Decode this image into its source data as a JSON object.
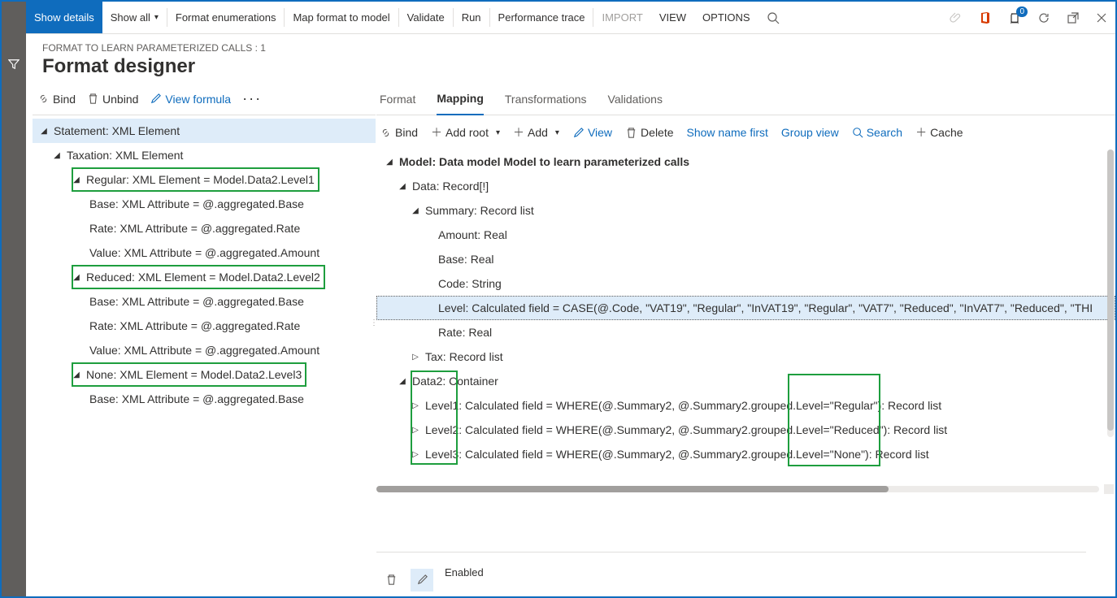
{
  "topbar": {
    "show_details": "Show details",
    "show_all": "Show all",
    "format_enum": "Format enumerations",
    "map_format": "Map format to model",
    "validate": "Validate",
    "run": "Run",
    "trace": "Performance trace",
    "import": "IMPORT",
    "view": "VIEW",
    "options": "OPTIONS",
    "notif_count": "0"
  },
  "header": {
    "crumb": "FORMAT TO LEARN PARAMETERIZED CALLS : 1",
    "title": "Format designer"
  },
  "left_tb": {
    "bind": "Bind",
    "unbind": "Unbind",
    "view_formula": "View formula"
  },
  "left_tree": {
    "n0": "Statement: XML Element",
    "n1": "Taxation: XML Element",
    "n2": "Regular: XML Element = Model.Data2.Level1",
    "n2a": "Base: XML Attribute = @.aggregated.Base",
    "n2b": "Rate: XML Attribute = @.aggregated.Rate",
    "n2c": "Value: XML Attribute = @.aggregated.Amount",
    "n3": "Reduced: XML Element = Model.Data2.Level2",
    "n3a": "Base: XML Attribute = @.aggregated.Base",
    "n3b": "Rate: XML Attribute = @.aggregated.Rate",
    "n3c": "Value: XML Attribute = @.aggregated.Amount",
    "n4": "None: XML Element = Model.Data2.Level3",
    "n4a": "Base: XML Attribute = @.aggregated.Base"
  },
  "tabs": {
    "format": "Format",
    "mapping": "Mapping",
    "transformations": "Transformations",
    "validations": "Validations"
  },
  "right_tb": {
    "bind": "Bind",
    "add_root": "Add root",
    "add": "Add",
    "view": "View",
    "delete": "Delete",
    "show_name": "Show name first",
    "group_view": "Group view",
    "search": "Search",
    "cache": "Cache"
  },
  "right_tree": {
    "r0": "Model: Data model Model to learn parameterized calls",
    "r1": "Data: Record[!]",
    "r2": "Summary: Record list",
    "r2a": "Amount: Real",
    "r2b": "Base: Real",
    "r2c": "Code: String",
    "r2d": "Level: Calculated field = CASE(@.Code, \"VAT19\", \"Regular\", \"InVAT19\", \"Regular\", \"VAT7\", \"Reduced\", \"InVAT7\", \"Reduced\", \"THI",
    "r2e": "Rate: Real",
    "r3": "Tax: Record list",
    "r4": "Data2: Container",
    "r4a": "Level1: Calculated field = WHERE(@.Summary2, @.Summary2.grouped.Level=\"Regular\"): Record list",
    "r4b": "Level2: Calculated field = WHERE(@.Summary2, @.Summary2.grouped.Level=\"Reduced\"): Record list",
    "r4c": "Level3: Calculated field = WHERE(@.Summary2, @.Summary2.grouped.Level=\"None\"): Record list"
  },
  "bottom": {
    "enabled": "Enabled"
  }
}
